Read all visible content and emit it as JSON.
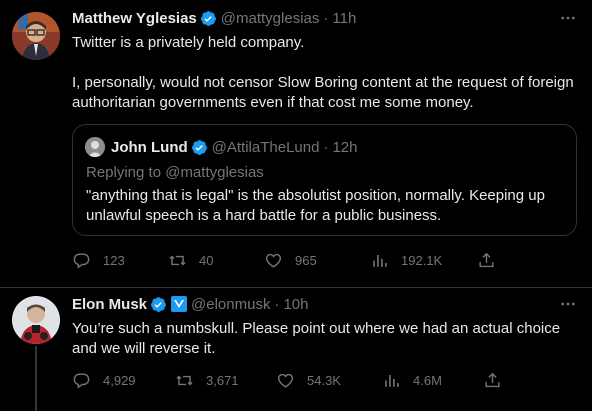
{
  "tweets": [
    {
      "author_name": "Matthew Yglesias",
      "handle": "@mattyglesias",
      "time": "11h",
      "text_lines": [
        "Twitter is a privately held company.",
        "I, personally, would not censor Slow Boring content at the request of foreign authoritarian governments even if that cost me some money."
      ],
      "quote": {
        "author_name": "John Lund",
        "handle": "@AttilaTheLund",
        "time": "12h",
        "replying_to": "Replying to @mattyglesias",
        "text": "\"anything that is legal\" is the absolutist position, normally.  Keeping up unlawful speech is a hard battle for a public business."
      },
      "stats": {
        "replies": "123",
        "retweets": "40",
        "likes": "965",
        "views": "192.1K"
      }
    },
    {
      "author_name": "Elon Musk",
      "handle": "@elonmusk",
      "time": "10h",
      "text": "You’re such a numbskull. Please point out where we had an actual choice and we will reverse it.",
      "stats": {
        "replies": "4,929",
        "retweets": "3,671",
        "likes": "54.3K",
        "views": "4.6M"
      }
    }
  ],
  "separator": "·",
  "colors": {
    "background": "#000000",
    "text": "#e7e9ea",
    "muted": "#71767b",
    "verified_blue": "#1d9bf0",
    "border": "#2f3336"
  },
  "icons": [
    "verified-badge-icon",
    "affiliate-badge-icon",
    "more-icon",
    "reply-icon",
    "retweet-icon",
    "like-icon",
    "views-icon",
    "share-icon"
  ]
}
